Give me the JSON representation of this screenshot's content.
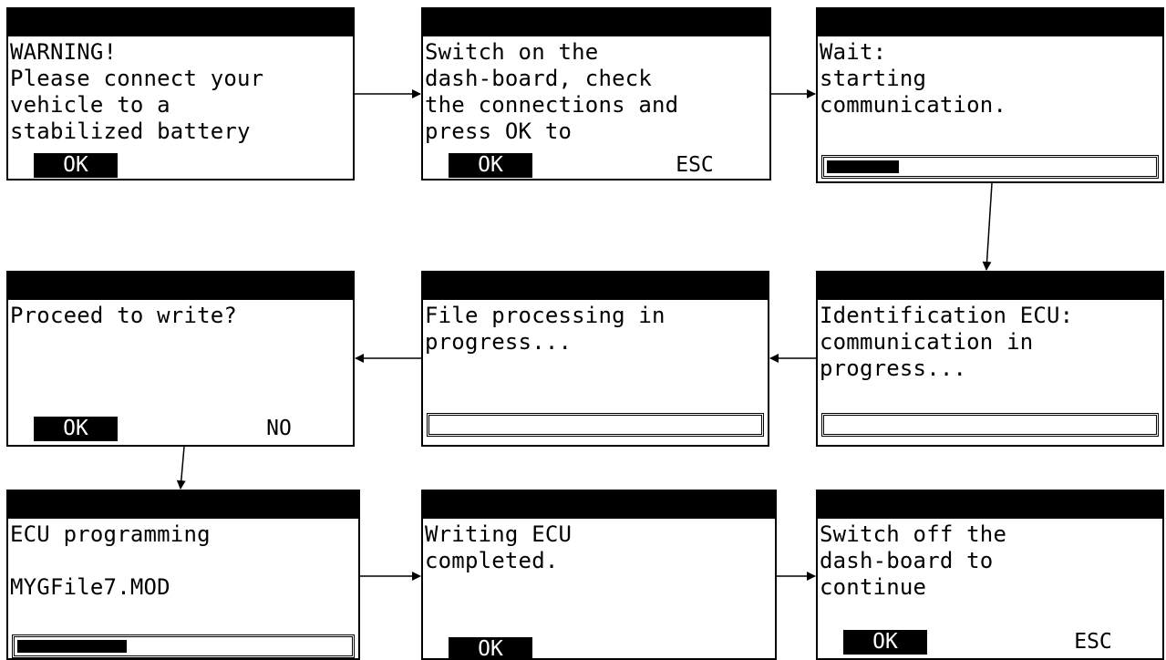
{
  "screens": [
    {
      "lines": [
        "WARNING!",
        "Please connect your",
        "vehicle to a",
        "stabilized battery"
      ],
      "buttons": [
        "OK"
      ]
    },
    {
      "lines": [
        "Switch on the",
        "dash-board, check",
        "the connections and",
        "press OK to"
      ],
      "buttons": [
        "OK",
        "ESC"
      ]
    },
    {
      "lines": [
        "Wait:",
        "starting",
        "communication."
      ],
      "progress": 0.22
    },
    {
      "lines": [
        "Identification ECU:",
        "communication in",
        "progress..."
      ],
      "progress": 0
    },
    {
      "lines": [
        "File processing in",
        "progress..."
      ],
      "progress": 0
    },
    {
      "lines": [
        "Proceed to write?"
      ],
      "buttons": [
        "OK",
        "NO"
      ]
    },
    {
      "lines": [
        "ECU programming",
        "",
        "MYGFile7.MOD"
      ],
      "progress": 0.33
    },
    {
      "lines": [
        "Writing ECU",
        "completed."
      ],
      "buttons": [
        "OK"
      ]
    },
    {
      "lines": [
        "Switch off the",
        "dash-board to",
        "continue"
      ],
      "buttons": [
        "OK",
        "ESC"
      ]
    }
  ]
}
